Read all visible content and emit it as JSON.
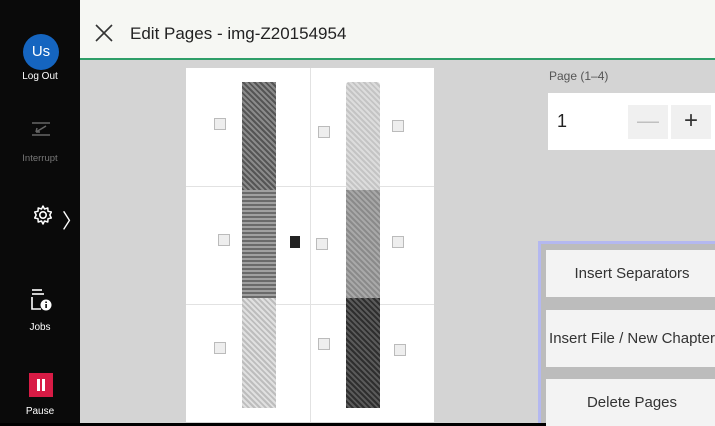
{
  "header": {
    "title": "Edit Pages - img-Z20154954"
  },
  "sidebar": {
    "avatar_text": "Us",
    "logout_label": "Log Out",
    "interrupt_label": "Interrupt",
    "settings_chevron": "〉",
    "jobs_label": "Jobs",
    "pause_label": "Pause"
  },
  "page_control": {
    "label": "Page (1–4)",
    "value": "1",
    "minus": "—",
    "plus": "+"
  },
  "actions": {
    "insert_separators": "Insert Separators",
    "insert_file": "Insert File / New Chapter",
    "delete_pages": "Delete Pages"
  },
  "colors": {
    "accent_green": "#2e9e68",
    "avatar_blue": "#1565c0",
    "pause_red": "#d81b45"
  }
}
